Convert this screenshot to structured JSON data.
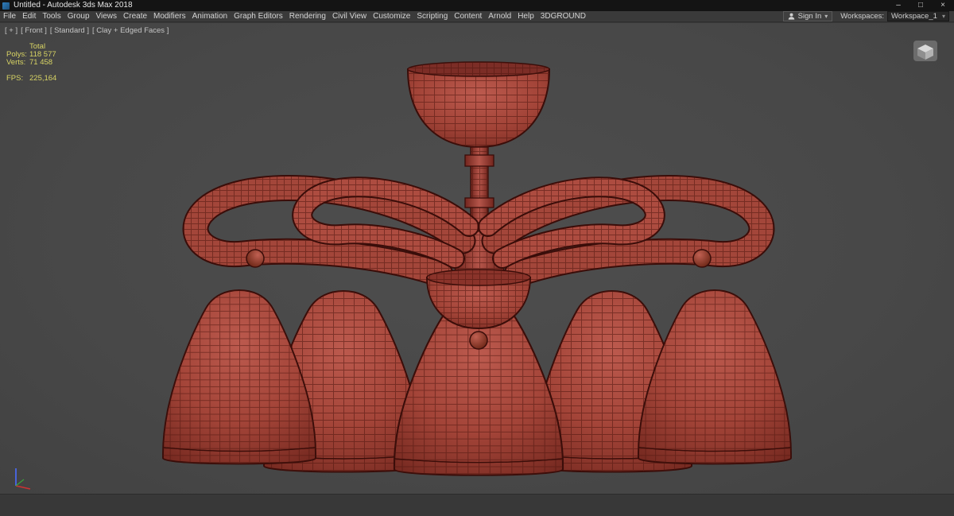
{
  "window": {
    "title": "Untitled - Autodesk 3ds Max 2018",
    "minimize_glyph": "–",
    "maximize_glyph": "□",
    "close_glyph": "×"
  },
  "menubar": {
    "items": [
      "File",
      "Edit",
      "Tools",
      "Group",
      "Views",
      "Create",
      "Modifiers",
      "Animation",
      "Graph Editors",
      "Rendering",
      "Civil View",
      "Customize",
      "Scripting",
      "Content",
      "Arnold",
      "Help",
      "3DGROUND"
    ],
    "sign_in_label": "Sign In",
    "sign_in_arrow": "▾",
    "workspaces_label": "Workspaces:",
    "workspace_value": "Workspace_1",
    "workspace_arrow": "▾"
  },
  "viewport": {
    "label_plus": "[ + ]",
    "label_view": "[ Front ]",
    "label_renderer": "[ Standard ]",
    "label_shading": "[ Clay + Edged Faces ]",
    "stats": {
      "total_header": "Total",
      "polys_label": "Polys:",
      "polys_value": "118 577",
      "verts_label": "Verts:",
      "verts_value": "71 458",
      "fps_label": "FPS:",
      "fps_value": "225,164"
    },
    "model": "chandelier-5-shades-wireframe",
    "colors": {
      "viewport_bg": "#4a4a4a",
      "model_base": "#a34438",
      "model_highlight": "#bc5a4e",
      "model_shadow": "#7c2d24",
      "wire_lines": "#4e150f",
      "stats_text": "#d8d464",
      "titlebar_bg": "#141414",
      "menubar_bg": "#3a3a3a"
    }
  }
}
